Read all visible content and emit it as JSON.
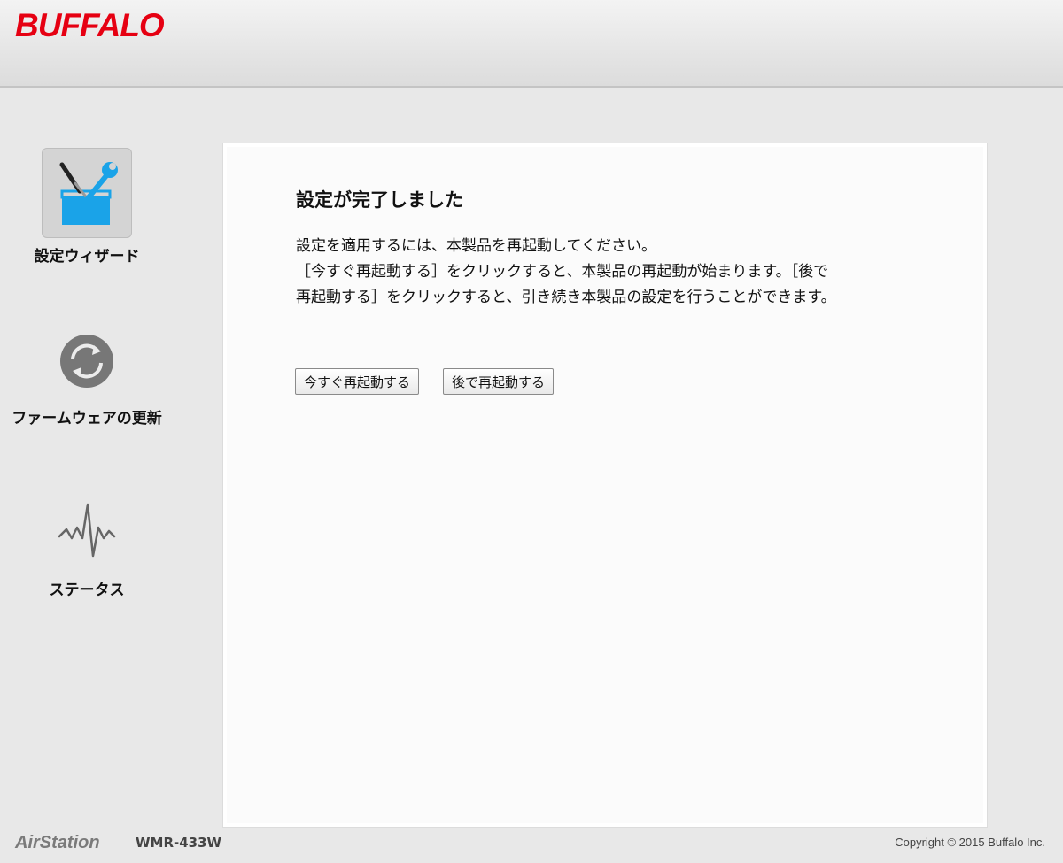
{
  "header": {
    "logo_text": "BUFFALO"
  },
  "sidebar": {
    "items": [
      {
        "label": "設定ウィザード",
        "icon": "toolbox-wrench-icon"
      },
      {
        "label": "ファームウェアの更新",
        "icon": "refresh-circle-icon"
      },
      {
        "label": "ステータス",
        "icon": "pulse-icon"
      }
    ]
  },
  "main": {
    "title": "設定が完了しました",
    "message_lines": [
      "設定を適用するには、本製品を再起動してください。",
      "［今すぐ再起動する］をクリックすると、本製品の再起動が始まります。［後で",
      "再起動する］をクリックすると、引き続き本製品の設定を行うことができます。"
    ],
    "restart_now_label": "今すぐ再起動する",
    "restart_later_label": "後で再起動する"
  },
  "footer": {
    "brand": "AirStation",
    "model": "WMR-433W",
    "copyright": "Copyright © 2015 Buffalo Inc."
  },
  "colors": {
    "brand_red": "#e60012",
    "toolbox_blue": "#1aa3e8",
    "icon_gray": "#777777"
  }
}
